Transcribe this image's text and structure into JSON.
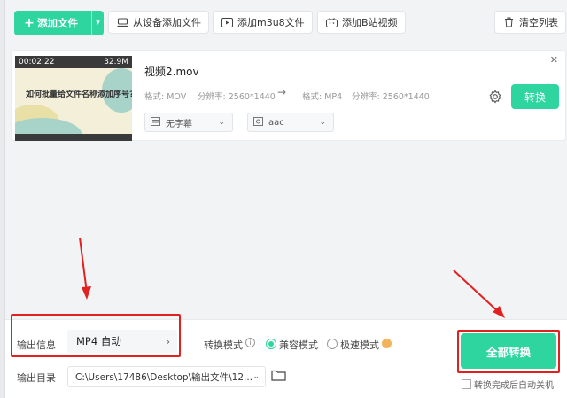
{
  "toolbar": {
    "add_file": "添加文件",
    "from_device": "从设备添加文件",
    "add_m3u8": "添加m3u8文件",
    "add_bilibili": "添加B站视频",
    "clear_list": "清空列表"
  },
  "file": {
    "name": "视频2.mov",
    "thumb_time": "00:02:22",
    "thumb_size": "32.9M",
    "thumb_title": "如何批量给文件名称添加序号?",
    "src_format_label": "格式:",
    "src_format": "MOV",
    "src_res_label": "分辨率:",
    "src_res": "2560*1440",
    "dst_format_label": "格式:",
    "dst_format": "MP4",
    "dst_res_label": "分辨率:",
    "dst_res": "2560*1440",
    "subtitle": "无字幕",
    "audio": "aac",
    "convert": "转换"
  },
  "output": {
    "info_label": "输出信息",
    "info_value": "MP4 自动",
    "mode_label": "转换模式",
    "mode_compatible": "兼容模式",
    "mode_fast": "极速模式",
    "dir_label": "输出目录",
    "dir_value": "C:\\Users\\17486\\Desktop\\输出文件\\12...",
    "convert_all": "全部转换",
    "shutdown": "转换完成后自动关机"
  },
  "colors": {
    "accent": "#2ed59e",
    "annotation": "#e32020"
  }
}
